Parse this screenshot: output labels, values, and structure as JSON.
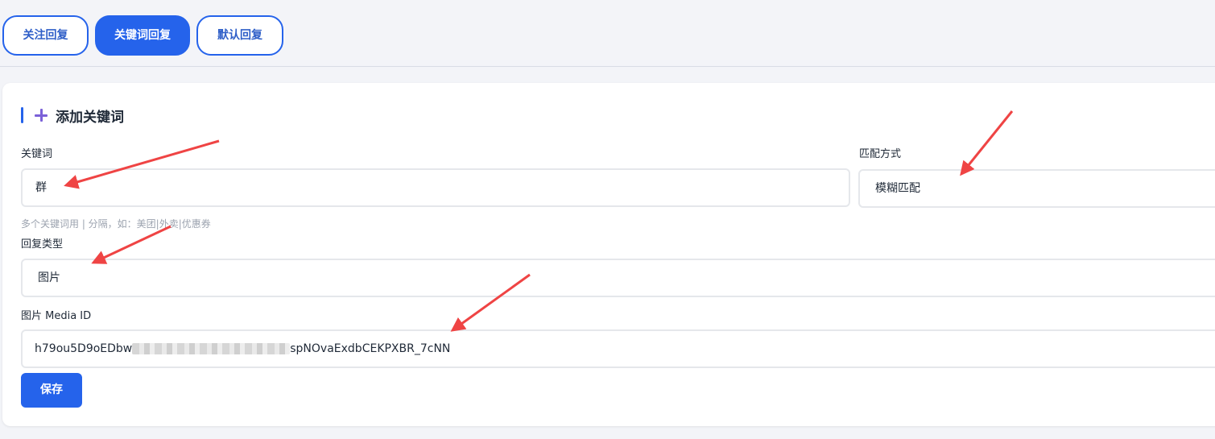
{
  "tabs": [
    {
      "label": "关注回复",
      "active": false
    },
    {
      "label": "关键词回复",
      "active": true
    },
    {
      "label": "默认回复",
      "active": false
    }
  ],
  "section": {
    "title": "添加关键词",
    "icon": "plus-icon"
  },
  "form": {
    "keyword_label": "关键词",
    "keyword_value": "群",
    "keyword_hint": "多个关键词用 | 分隔，如：美团|外卖|优惠券",
    "match_label": "匹配方式",
    "match_value": "模糊匹配",
    "reply_type_label": "回复类型",
    "reply_type_value": "图片",
    "media_label": "图片 Media ID",
    "media_value_start": "h79ou5D9oEDbw",
    "media_value_end": "spNOvaExdbCEKPXBR_7cNN",
    "save_label": "保存"
  },
  "colors": {
    "accent": "#2563eb",
    "annotation_arrow": "#ef4444",
    "plus_icon": "#7b61d8"
  }
}
